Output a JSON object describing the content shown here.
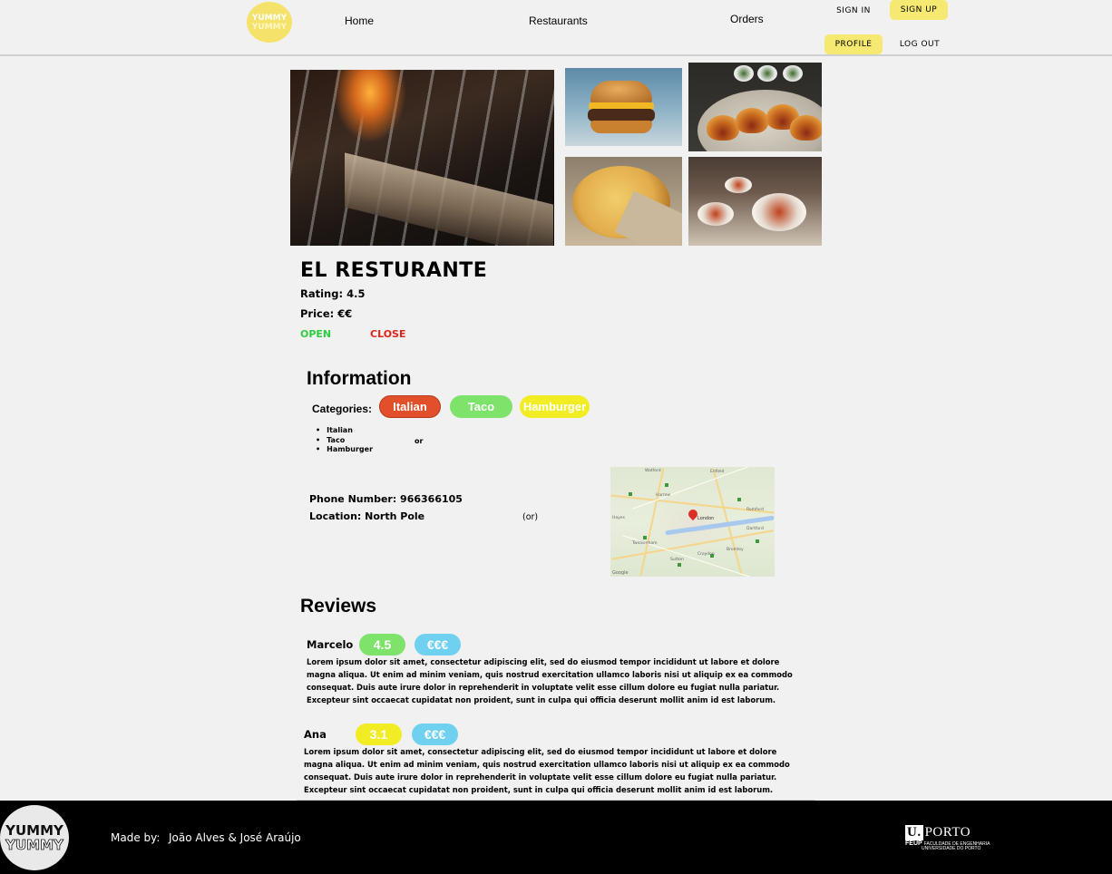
{
  "header": {
    "logo_line1": "YUMMY",
    "logo_line2": "YUMMY",
    "nav": {
      "home": "Home",
      "restaurants": "Restaurants",
      "orders": "Orders"
    },
    "sign_in": "SIGN IN",
    "sign_up": "SIGN UP",
    "profile": "PROFILE",
    "log_out": "LOG OUT"
  },
  "restaurant": {
    "name": "EL RESTURANTE",
    "rating_text": "Rating: 4.5",
    "price_text": "Price: €€",
    "status_open": "OPEN",
    "status_close": "CLOSE"
  },
  "information": {
    "heading": "Information",
    "categories_label": "Categories:",
    "category_pills": [
      "Italian",
      "Taco",
      "Hamburger"
    ],
    "category_list": [
      "Italian",
      "Taco",
      "Hamburger"
    ],
    "or_text": "or",
    "phone_text": "Phone Number: 966366105",
    "location_text": "Location: North Pole",
    "or_paren": "(or)"
  },
  "map": {
    "pin_label": "London",
    "attribution": "Google",
    "towns": [
      "Watford",
      "Enfield",
      "Harrow",
      "Romford",
      "Hayes",
      "Croydon",
      "Bromley",
      "Sutton",
      "Twickenham",
      "Dartford"
    ]
  },
  "reviews": {
    "heading": "Reviews",
    "items": [
      {
        "name": "Marcelo",
        "score": "4.5",
        "price": "€€€",
        "text": "Lorem ipsum dolor sit amet, consectetur adipiscing elit, sed do eiusmod tempor incididunt ut labore et dolore magna aliqua. Ut enim ad minim veniam, quis nostrud exercitation ullamco laboris nisi ut aliquip ex ea commodo consequat. Duis aute irure dolor in reprehenderit in voluptate velit esse cillum dolore eu fugiat nulla pariatur. Excepteur sint occaecat cupidatat non proident, sunt in culpa qui officia deserunt mollit anim id est laborum."
      },
      {
        "name": "Ana",
        "score": "3.1",
        "price": "€€€",
        "text": "Lorem ipsum dolor sit amet, consectetur adipiscing elit, sed do eiusmod tempor incididunt ut labore et dolore magna aliqua. Ut enim ad minim veniam, quis nostrud exercitation ullamco laboris nisi ut aliquip ex ea commodo consequat. Duis aute irure dolor in reprehenderit in voluptate velit esse cillum dolore eu fugiat nulla pariatur. Excepteur sint occaecat cupidatat non proident, sunt in culpa qui officia deserunt mollit anim id est laborum."
      }
    ]
  },
  "footer": {
    "logo_line1": "YUMMY",
    "logo_line2": "YUMMY",
    "made_by": "Made by:",
    "authors": "João Alves & José Araújo",
    "uporto_u": "U.",
    "uporto_name": "PORTO",
    "feup_acronym": "FEUP",
    "feup_line1": "FACULDADE DE ENGENHARIA",
    "feup_line2": "UNIVERSIDADE DO PORTO"
  },
  "colors": {
    "accent_yellow": "#f5e971",
    "open_green": "#2ecc40",
    "close_red": "#e0241b",
    "pill_italian": "#e1502a",
    "pill_taco": "#7ee36a",
    "pill_hamburger": "#f1ec24",
    "score_high": "#7ee36a",
    "score_mid": "#f1ec24",
    "price_pill": "#6fd0f0"
  }
}
